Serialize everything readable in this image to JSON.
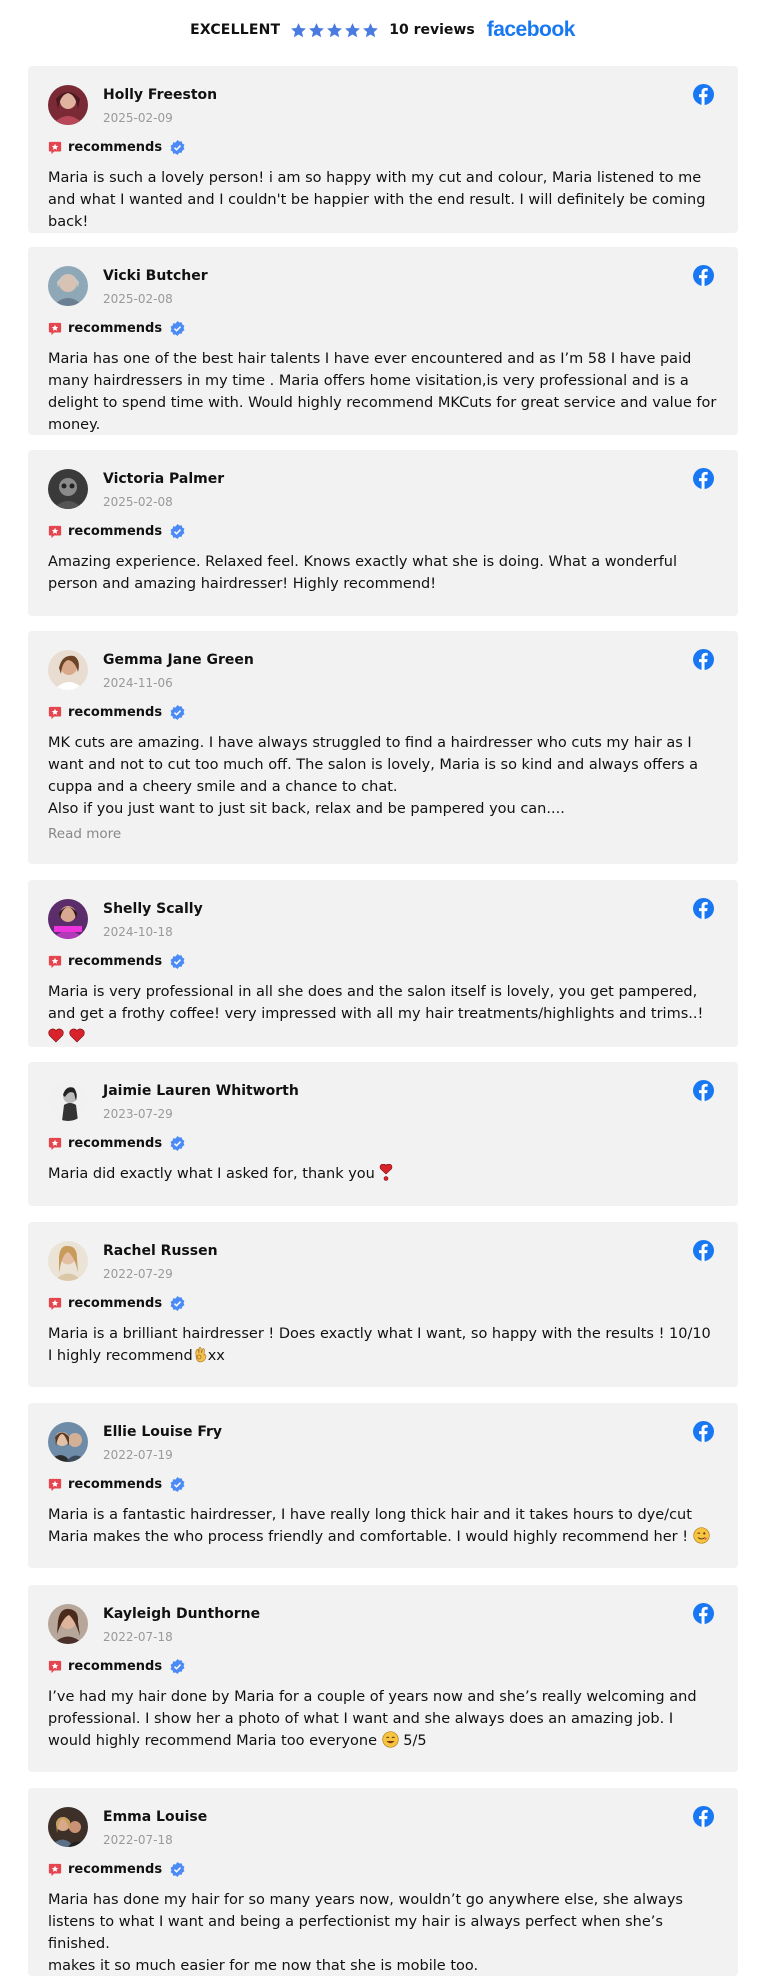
{
  "header": {
    "rating_word": "EXCELLENT",
    "review_count": "10 reviews",
    "brand": "facebook",
    "star_count": 5,
    "star_color": "#4A7BE0"
  },
  "colors": {
    "facebook_blue": "#1877F2",
    "card_bg": "#f2f2f2",
    "recommend_red": "#E4454E",
    "verified_blue": "#4C8BF5"
  },
  "reviews": [
    {
      "name": "Holly Freeston",
      "date": "2025-02-09",
      "recommend_label": "recommends",
      "lines": [
        "Maria is such a lovely person! i am so happy with my cut and colour, Maria listened to me and what I wanted and I couldn't be happier with the end result. I will definitely be coming back!"
      ]
    },
    {
      "name": "Vicki Butcher",
      "date": "2025-02-08",
      "recommend_label": "recommends",
      "lines": [
        "Maria has one of the best hair talents I have ever encountered and as I’m 58 I have paid many hairdressers in my time . Maria offers home visitation,is very professional and is a delight to spend time with. Would highly recommend MKCuts for great service and value for money."
      ]
    },
    {
      "name": "Victoria Palmer",
      "date": "2025-02-08",
      "recommend_label": "recommends",
      "lines": [
        "Amazing experience. Relaxed feel. Knows exactly what she is doing. What a wonderful person and amazing hairdresser! Highly recommend!"
      ]
    },
    {
      "name": "Gemma Jane Green",
      "date": "2024-11-06",
      "recommend_label": "recommends",
      "lines": [
        "MK cuts are amazing. I have always struggled to find a hairdresser who cuts my hair as I want and not to cut too much off. The salon is lovely, Maria is so kind and always offers a cuppa and a cheery smile and a chance to chat.",
        "Also if you just want to just sit back, relax and be pampered you can...."
      ],
      "read_more": "Read more"
    },
    {
      "name": "Shelly Scally",
      "date": "2024-10-18",
      "recommend_label": "recommends",
      "lines": [
        "Maria is very professional in all she does and the salon itself is lovely, you get pampered, and get a frothy coffee! very impressed with all my hair treatments/highlights and trims..!"
      ],
      "emoji": "hearts"
    },
    {
      "name": "Jaimie Lauren Whitworth",
      "date": "2023-07-29",
      "recommend_label": "recommends",
      "lines": [
        "Maria did exactly what I asked for, thank you"
      ],
      "emoji": "heart-exclamation"
    },
    {
      "name": "Rachel Russen",
      "date": "2022-07-29",
      "recommend_label": "recommends",
      "lines": [
        "Maria is a brilliant hairdresser ! Does exactly what I want, so happy with the results ! 10/10",
        "I highly recommend"
      ],
      "line2_suffix": "xx",
      "emoji": "ok-hand"
    },
    {
      "name": "Ellie Louise Fry",
      "date": "2022-07-19",
      "recommend_label": "recommends",
      "lines": [
        "Maria is a fantastic hairdresser, I have really long thick hair and it takes hours to dye/cut Maria makes the who process friendly and comfortable. I would highly recommend her !"
      ],
      "emoji": "wink"
    },
    {
      "name": "Kayleigh Dunthorne",
      "date": "2022-07-18",
      "recommend_label": "recommends",
      "lines": [
        "I’ve had my hair done by Maria for a couple of years now and she’s really welcoming and professional. I show her a photo of what I want and she always does an amazing job. I would highly recommend Maria too everyone"
      ],
      "line_suffix": " 5/5",
      "emoji": "smile"
    },
    {
      "name": "Emma Louise",
      "date": "2022-07-18",
      "recommend_label": "recommends",
      "lines": [
        "Maria has done my hair for so many years now, wouldn’t go anywhere else, she always listens to what I want and being a perfectionist my hair is always perfect when she’s finished.",
        "makes it so much easier for me now that she is mobile too."
      ]
    }
  ]
}
